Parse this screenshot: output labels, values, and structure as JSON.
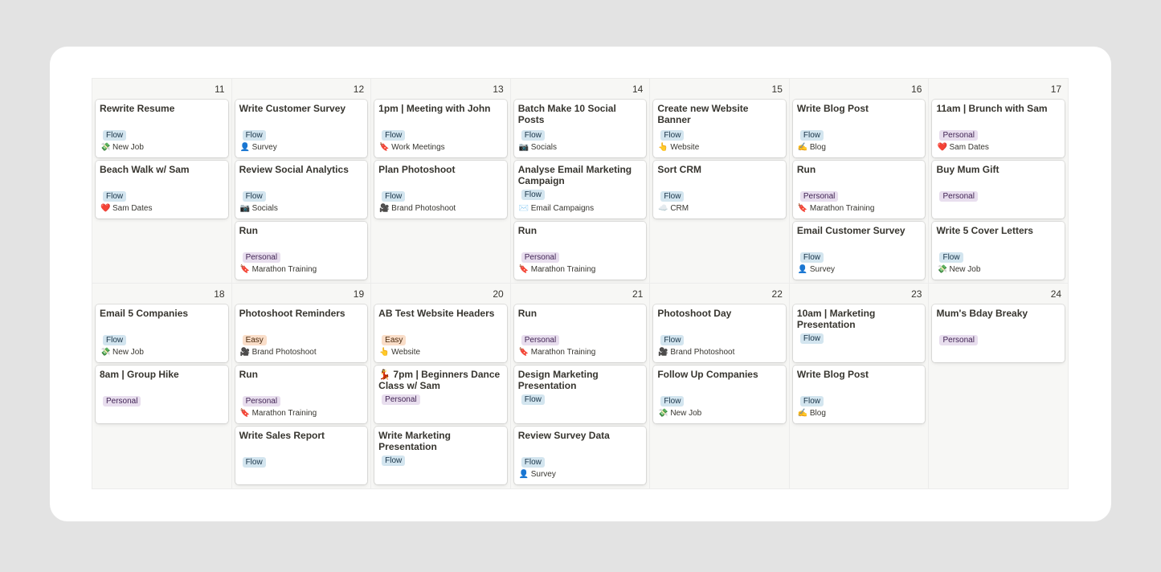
{
  "weeks": [
    {
      "days": [
        {
          "number": "11",
          "events": [
            {
              "title": "Rewrite Resume",
              "tag": "Flow",
              "meta": "New Job",
              "icon": "money-icon",
              "glyph": "💸"
            },
            {
              "title": "Beach Walk w/ Sam",
              "tag": "Flow",
              "meta": "Sam Dates",
              "icon": "heart-icon",
              "glyph": "❤️"
            }
          ]
        },
        {
          "number": "12",
          "events": [
            {
              "title": "Write Customer Survey",
              "tag": "Flow",
              "meta": "Survey",
              "icon": "person-icon",
              "glyph": "👤"
            },
            {
              "title": "Review Social Analytics",
              "tag": "Flow",
              "meta": "Socials",
              "icon": "camera-icon",
              "glyph": "📷"
            },
            {
              "title": "Run",
              "tag": "Personal",
              "meta": "Marathon Training",
              "icon": "bookmark-icon",
              "glyph": "🔖"
            }
          ]
        },
        {
          "number": "13",
          "events": [
            {
              "title": "1pm | Meeting with John",
              "tag": "Flow",
              "meta": "Work Meetings",
              "icon": "bookmark-icon",
              "glyph": "🔖"
            },
            {
              "title": "Plan Photoshoot",
              "tag": "Flow",
              "meta": "Brand Photoshoot",
              "icon": "movie-camera-icon",
              "glyph": "🎥"
            }
          ]
        },
        {
          "number": "14",
          "events": [
            {
              "title": "Batch Make 10 Social Posts",
              "tag": "Flow",
              "meta": "Socials",
              "icon": "camera-icon",
              "glyph": "📷"
            },
            {
              "title": "Analyse Email Marketing Campaign",
              "tag": "Flow",
              "meta": "Email Campaigns",
              "icon": "envelope-icon",
              "glyph": "✉️"
            },
            {
              "title": "Run",
              "tag": "Personal",
              "meta": "Marathon Training",
              "icon": "bookmark-icon",
              "glyph": "🔖"
            }
          ]
        },
        {
          "number": "15",
          "events": [
            {
              "title": "Create new Website Banner",
              "tag": "Flow",
              "meta": "Website",
              "icon": "pointer-icon",
              "glyph": "👆"
            },
            {
              "title": "Sort CRM",
              "tag": "Flow",
              "meta": "CRM",
              "icon": "cloud-icon",
              "glyph": "☁️"
            }
          ]
        },
        {
          "number": "16",
          "events": [
            {
              "title": "Write Blog Post",
              "tag": "Flow",
              "meta": "Blog",
              "icon": "writing-hand-icon",
              "glyph": "✍️"
            },
            {
              "title": "Run",
              "tag": "Personal",
              "meta": "Marathon Training",
              "icon": "bookmark-icon",
              "glyph": "🔖"
            },
            {
              "title": "Email Customer Survey",
              "tag": "Flow",
              "meta": "Survey",
              "icon": "person-icon",
              "glyph": "👤"
            }
          ]
        },
        {
          "number": "17",
          "events": [
            {
              "title": "11am | Brunch with Sam",
              "tag": "Personal",
              "meta": "Sam Dates",
              "icon": "heart-icon",
              "glyph": "❤️"
            },
            {
              "title": "Buy Mum Gift",
              "tag": "Personal",
              "meta": "",
              "icon": "",
              "glyph": ""
            },
            {
              "title": "Write 5 Cover Letters",
              "tag": "Flow",
              "meta": "New Job",
              "icon": "money-icon",
              "glyph": "💸"
            }
          ]
        }
      ]
    },
    {
      "days": [
        {
          "number": "18",
          "events": [
            {
              "title": "Email 5 Companies",
              "tag": "Flow",
              "meta": "New Job",
              "icon": "money-icon",
              "glyph": "💸"
            },
            {
              "title": "8am | Group Hike",
              "tag": "Personal",
              "meta": "",
              "icon": "",
              "glyph": ""
            }
          ]
        },
        {
          "number": "19",
          "events": [
            {
              "title": "Photoshoot Reminders",
              "tag": "Easy",
              "meta": "Brand Photoshoot",
              "icon": "movie-camera-icon",
              "glyph": "🎥"
            },
            {
              "title": "Run",
              "tag": "Personal",
              "meta": "Marathon Training",
              "icon": "bookmark-icon",
              "glyph": "🔖"
            },
            {
              "title": "Write Sales Report",
              "tag": "Flow",
              "meta": "",
              "icon": "",
              "glyph": ""
            }
          ]
        },
        {
          "number": "20",
          "events": [
            {
              "title": "AB Test Website Headers",
              "tag": "Easy",
              "meta": "Website",
              "icon": "pointer-icon",
              "glyph": "👆"
            },
            {
              "title": "💃 7pm | Beginners Dance Class w/ Sam",
              "tag": "Personal",
              "meta": "",
              "icon": "",
              "glyph": ""
            },
            {
              "title": "Write Marketing Presentation",
              "tag": "Flow",
              "meta": "",
              "icon": "",
              "glyph": ""
            }
          ]
        },
        {
          "number": "21",
          "events": [
            {
              "title": "Run",
              "tag": "Personal",
              "meta": "Marathon Training",
              "icon": "bookmark-icon",
              "glyph": "🔖"
            },
            {
              "title": "Design Marketing Presentation",
              "tag": "Flow",
              "meta": "",
              "icon": "",
              "glyph": ""
            },
            {
              "title": "Review Survey Data",
              "tag": "Flow",
              "meta": "Survey",
              "icon": "person-icon",
              "glyph": "👤"
            }
          ]
        },
        {
          "number": "22",
          "events": [
            {
              "title": "Photoshoot Day",
              "tag": "Flow",
              "meta": "Brand Photoshoot",
              "icon": "movie-camera-icon",
              "glyph": "🎥"
            },
            {
              "title": "Follow Up Companies",
              "tag": "Flow",
              "meta": "New Job",
              "icon": "money-icon",
              "glyph": "💸"
            }
          ]
        },
        {
          "number": "23",
          "events": [
            {
              "title": "10am | Marketing Presentation",
              "tag": "Flow",
              "meta": "",
              "icon": "",
              "glyph": ""
            },
            {
              "title": "Write Blog Post",
              "tag": "Flow",
              "meta": "Blog",
              "icon": "writing-hand-icon",
              "glyph": "✍️"
            }
          ]
        },
        {
          "number": "24",
          "events": [
            {
              "title": "Mum's Bday Breaky",
              "tag": "Personal",
              "meta": "",
              "icon": "",
              "glyph": ""
            }
          ]
        }
      ]
    }
  ],
  "tag_colors": {
    "Flow": "#d3e5ef",
    "Personal": "#e8deee",
    "Easy": "#fadec9"
  }
}
